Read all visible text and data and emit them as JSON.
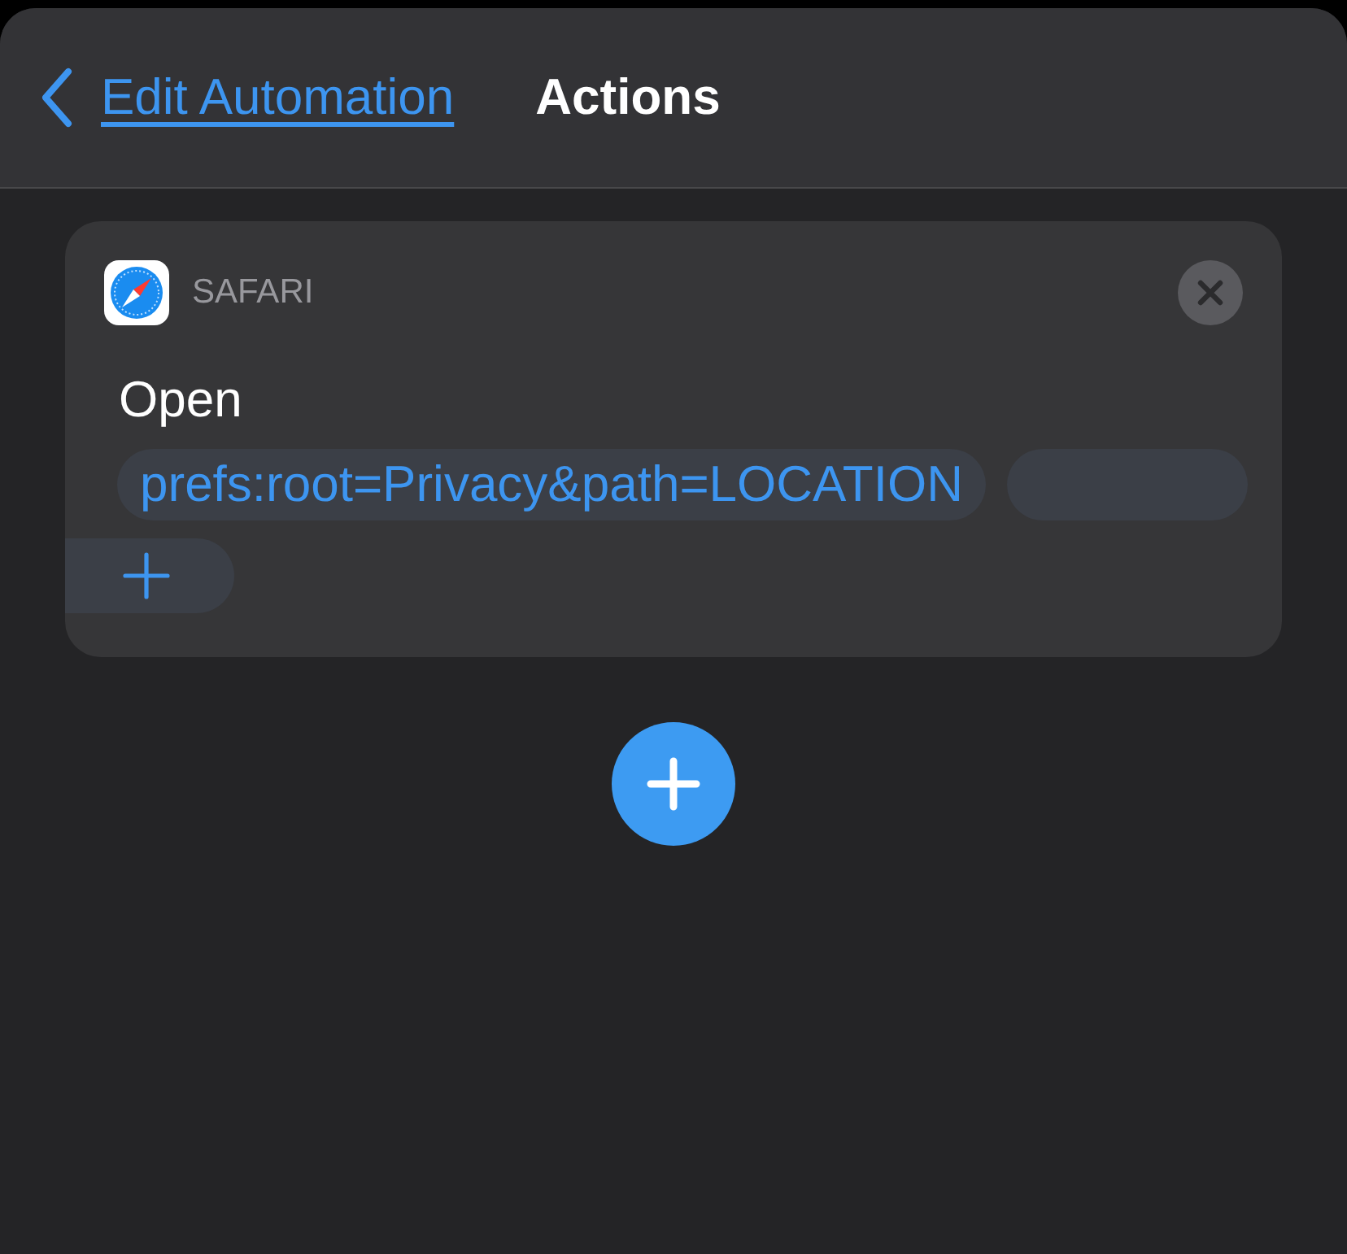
{
  "nav": {
    "back_label": "Edit Automation",
    "title": "Actions"
  },
  "action": {
    "app": "SAFARI",
    "verb": "Open",
    "url": "prefs:root=Privacy&path=LOCATION"
  }
}
